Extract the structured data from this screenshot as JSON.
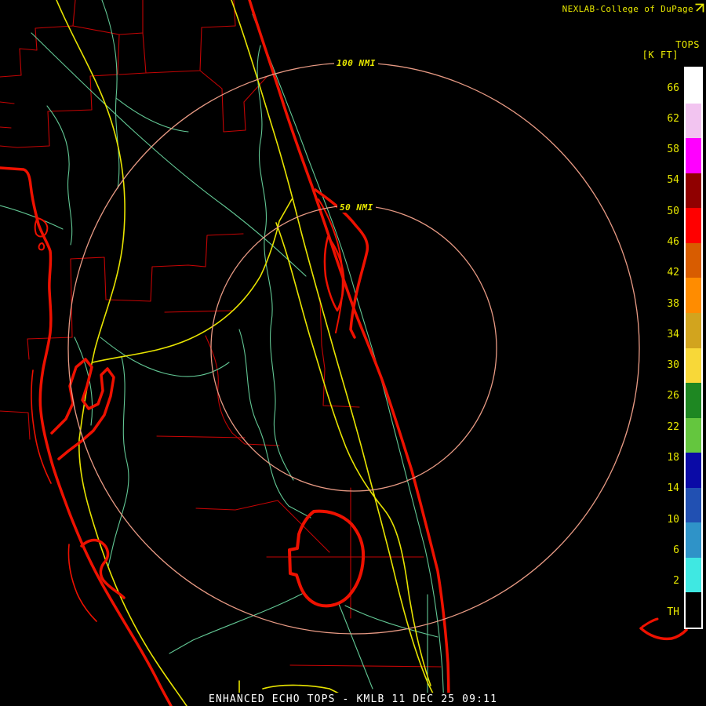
{
  "header": {
    "credit": "NEXLAB-College of DuPage",
    "logo_icon": "cod-flag-icon"
  },
  "legend": {
    "title_line1": "TOPS",
    "title_line2": "[K FT]",
    "labels": [
      "66",
      "62",
      "58",
      "54",
      "50",
      "46",
      "42",
      "38",
      "34",
      "30",
      "26",
      "22",
      "18",
      "14",
      "10",
      "6",
      "2",
      "TH"
    ],
    "segments": [
      {
        "name": "white",
        "color": "#ffffff"
      },
      {
        "name": "pale-pink",
        "color": "#f2c4f0"
      },
      {
        "name": "magenta",
        "color": "#ff00ff"
      },
      {
        "name": "dark-red",
        "color": "#900000"
      },
      {
        "name": "red",
        "color": "#ff0000"
      },
      {
        "name": "burnt-orange",
        "color": "#d85c00"
      },
      {
        "name": "orange",
        "color": "#ff8c00"
      },
      {
        "name": "gold",
        "color": "#d2a41e"
      },
      {
        "name": "yellow",
        "color": "#f8d838"
      },
      {
        "name": "dark-green",
        "color": "#1e8722"
      },
      {
        "name": "light-green",
        "color": "#64c63e"
      },
      {
        "name": "navy",
        "color": "#0a0aa6"
      },
      {
        "name": "royal-blue",
        "color": "#2150b2"
      },
      {
        "name": "steel-blue",
        "color": "#2f93c8"
      },
      {
        "name": "cyan",
        "color": "#3fe8e2"
      },
      {
        "name": "black",
        "color": "#000000"
      }
    ]
  },
  "rings": {
    "outer_label": "100 NMI",
    "inner_label": "50 NMI",
    "color": "#e89a84"
  },
  "status_bar": {
    "text": "ENHANCED ECHO TOPS - KMLB 11 DEC 25 09:11",
    "product": "ENHANCED ECHO TOPS",
    "site": "KMLB",
    "datetime": "11 DEC 25 09:11"
  },
  "map_colors": {
    "coastline": "#ee1100",
    "county": "#c40404",
    "river": "#62c794",
    "road": "#e8e400",
    "text_yellow": "#e8e800"
  }
}
